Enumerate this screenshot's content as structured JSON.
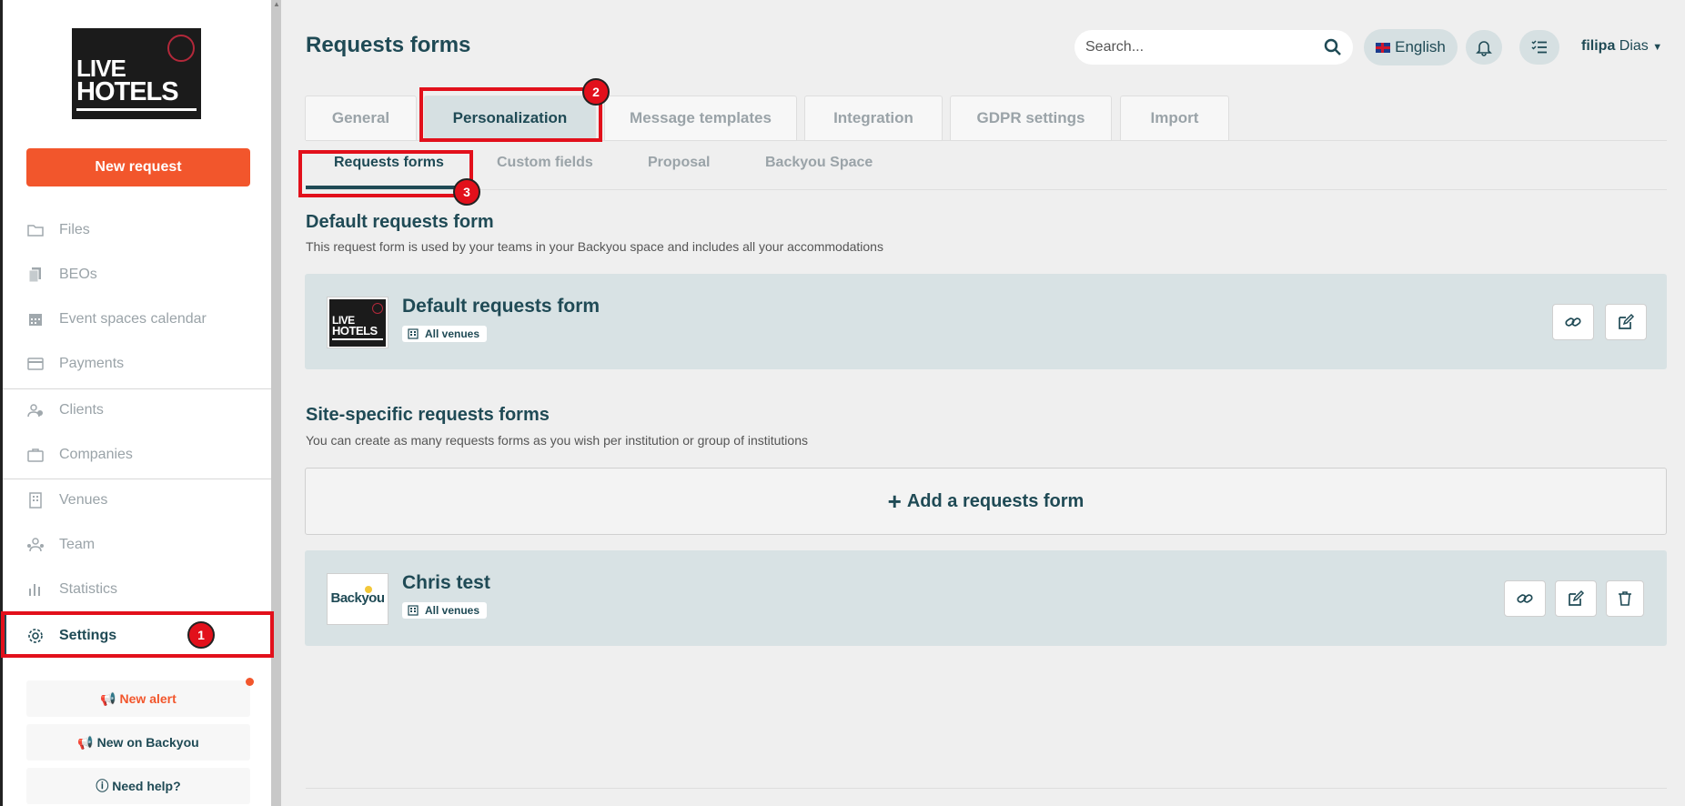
{
  "sidebar": {
    "logo": {
      "line1": "LIVE",
      "line2": "HOTELS"
    },
    "new_request": "New request",
    "items": [
      {
        "label": "Files",
        "icon": "folder-icon"
      },
      {
        "label": "BEOs",
        "icon": "copy-icon"
      },
      {
        "label": "Event spaces calendar",
        "icon": "calendar-icon"
      },
      {
        "label": "Payments",
        "icon": "credit-card-icon"
      },
      {
        "label": "Clients",
        "icon": "clients-icon"
      },
      {
        "label": "Companies",
        "icon": "briefcase-icon"
      },
      {
        "label": "Venues",
        "icon": "building-icon"
      },
      {
        "label": "Team",
        "icon": "team-icon"
      },
      {
        "label": "Statistics",
        "icon": "bar-chart-icon"
      },
      {
        "label": "Settings",
        "icon": "gear-icon"
      }
    ],
    "buttons": {
      "new_alert": "New alert",
      "new_on_backyou": "New on Backyou",
      "need_help": "Need help?"
    }
  },
  "header": {
    "title": "Requests forms",
    "search_placeholder": "Search...",
    "language": "English",
    "user_first": "filipa",
    "user_last": "Dias"
  },
  "tabs": [
    "General",
    "Personalization",
    "Message templates",
    "Integration",
    "GDPR settings",
    "Import"
  ],
  "active_tab": "Personalization",
  "subtabs": [
    "Requests forms",
    "Custom fields",
    "Proposal",
    "Backyou Space"
  ],
  "active_subtab": "Requests forms",
  "default_section": {
    "title": "Default requests form",
    "description": "This request form is used by your teams in your Backyou space and includes all your accommodations",
    "card": {
      "name": "Default requests form",
      "venues": "All venues"
    }
  },
  "site_section": {
    "title": "Site-specific requests forms",
    "description": "You can create as many requests forms as you wish per institution or group of institutions",
    "add_label": "Add a requests form",
    "card": {
      "name": "Chris test",
      "venues": "All venues",
      "thumb_text": "Backyou"
    }
  },
  "annotations": {
    "step1": "1",
    "step2": "2",
    "step3": "3"
  },
  "colors": {
    "accent": "#f2562c",
    "primary": "#1f4a55",
    "highlight": "#e2101b"
  }
}
